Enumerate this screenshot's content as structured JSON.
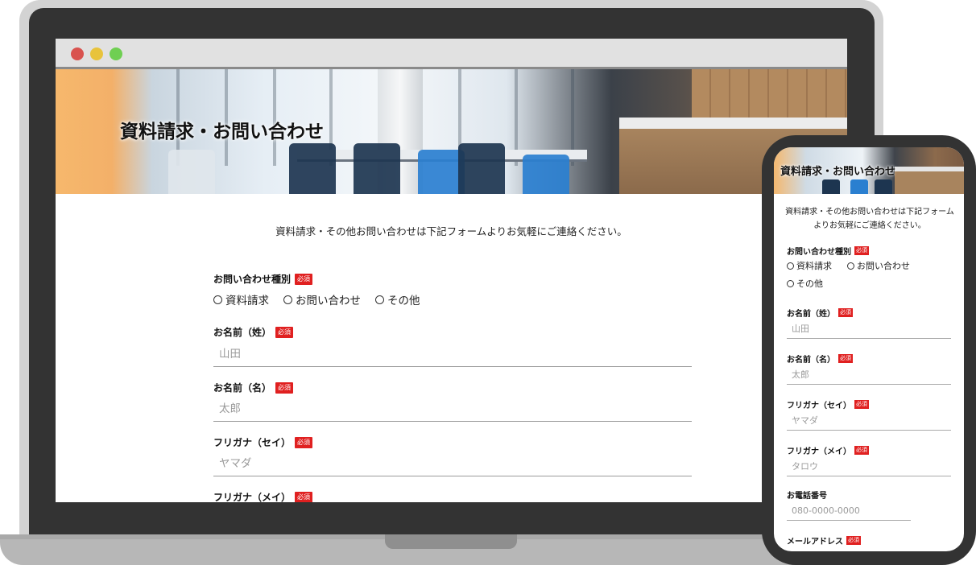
{
  "desktop": {
    "hero_title": "資料請求・お問い合わせ",
    "intro": "資料請求・その他お問い合わせは下記フォームよりお気軽にご連絡ください。",
    "required_badge": "必須",
    "inquiry_type": {
      "label": "お問い合わせ種別",
      "options": [
        "資料請求",
        "お問い合わせ",
        "その他"
      ]
    },
    "last_name": {
      "label": "お名前（姓）",
      "placeholder": "山田"
    },
    "first_name": {
      "label": "お名前（名）",
      "placeholder": "太郎"
    },
    "last_name_kana": {
      "label": "フリガナ（セイ）",
      "placeholder": "ヤマダ"
    },
    "first_name_kana": {
      "label": "フリガナ（メイ）"
    }
  },
  "mobile": {
    "hero_title": "資料請求・お問い合わせ",
    "intro_line1": "資料請求・その他お問い合わせは下記フォーム",
    "intro_line2": "よりお気軽にご連絡ください。",
    "required_badge": "必須",
    "inquiry_type": {
      "label": "お問い合わせ種別",
      "options": [
        "資料請求",
        "お問い合わせ",
        "その他"
      ]
    },
    "last_name": {
      "label": "お名前（姓）",
      "placeholder": "山田"
    },
    "first_name": {
      "label": "お名前（名）",
      "placeholder": "太郎"
    },
    "last_name_kana": {
      "label": "フリガナ（セイ）",
      "placeholder": "ヤマダ"
    },
    "first_name_kana": {
      "label": "フリガナ（メイ）",
      "placeholder": "タロウ"
    },
    "phone": {
      "label": "お電話番号",
      "placeholder": "080-0000-0000"
    },
    "email": {
      "label": "メールアドレス"
    }
  },
  "colors": {
    "required_badge": "#e02020",
    "device_frame": "#333333",
    "laptop_lid": "#d3d3d3",
    "browser_titlebar": "#e1e1e1",
    "dot_red": "#d9534f",
    "dot_yellow": "#e8c33c",
    "dot_green": "#6fcf52"
  }
}
